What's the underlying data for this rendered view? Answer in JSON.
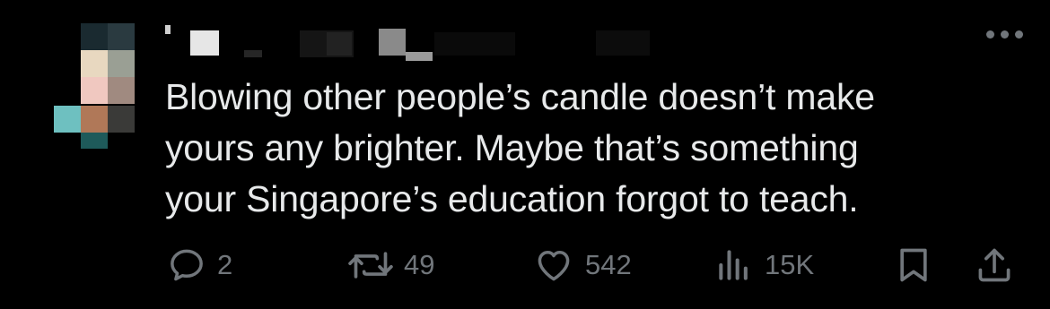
{
  "tweet": {
    "author_name": "",
    "author_handle": "",
    "text": "Blowing other people’s candle doesn’t make\nyours any brighter. Maybe that’s something\nyour Singapore’s education forgot to teach.",
    "actions": {
      "reply": {
        "icon": "reply-icon",
        "count": "2"
      },
      "retweet": {
        "icon": "retweet-icon",
        "count": "49"
      },
      "like": {
        "icon": "heart-icon",
        "count": "542"
      },
      "views": {
        "icon": "views-chart-icon",
        "count": "15K"
      },
      "bookmark": {
        "icon": "bookmark-icon"
      },
      "share": {
        "icon": "share-icon"
      }
    }
  },
  "colors": {
    "background": "#000000",
    "text": "#e7e9ea",
    "muted": "#71767b"
  }
}
